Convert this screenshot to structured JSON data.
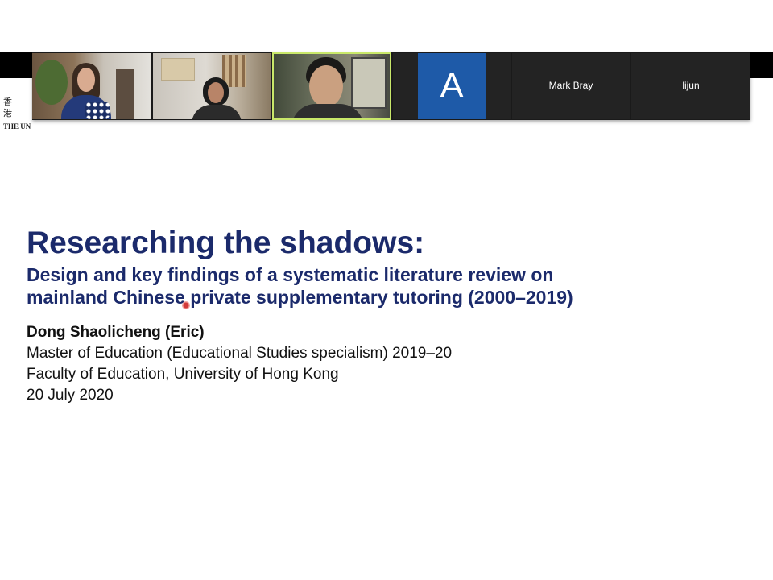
{
  "meeting": {
    "university_logo": {
      "cn": "香 港",
      "en": "THE UN"
    },
    "participants": [
      {
        "name": "",
        "type": "video"
      },
      {
        "name": "",
        "type": "video"
      },
      {
        "name": "",
        "type": "video",
        "active_speaker": true
      },
      {
        "name": "",
        "type": "avatar",
        "initial": "A",
        "avatar_color": "#1e5aa8"
      },
      {
        "name": "Mark Bray",
        "type": "name-only"
      },
      {
        "name": "lijun",
        "type": "name-only"
      }
    ],
    "active_speaker_border_color": "#c9e86a"
  },
  "slide": {
    "title": "Researching the shadows:",
    "subtitle_line1": "Design and key findings of a systematic literature review on",
    "subtitle_line2": "mainland Chinese private supplementary tutoring (2000–2019)",
    "author": "Dong Shaolicheng (Eric)",
    "program": "Master of Education (Educational Studies specialism) 2019–20",
    "faculty": "Faculty of Education, University of Hong Kong",
    "date": "20 July 2020",
    "title_color": "#1b2a6b"
  }
}
